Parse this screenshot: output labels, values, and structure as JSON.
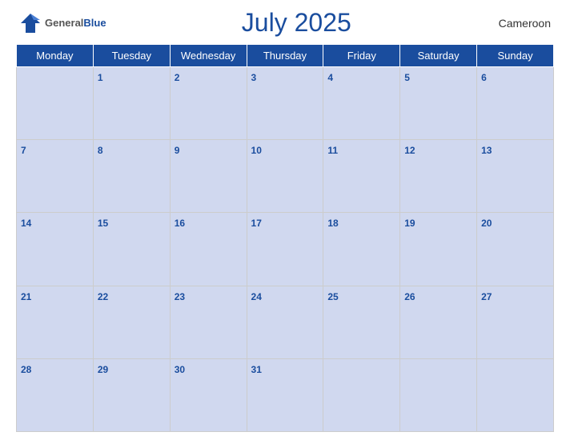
{
  "header": {
    "logo_general": "General",
    "logo_blue": "Blue",
    "title": "July 2025",
    "country": "Cameroon"
  },
  "days": [
    "Monday",
    "Tuesday",
    "Wednesday",
    "Thursday",
    "Friday",
    "Saturday",
    "Sunday"
  ],
  "weeks": [
    [
      null,
      1,
      2,
      3,
      4,
      5,
      6
    ],
    [
      7,
      8,
      9,
      10,
      11,
      12,
      13
    ],
    [
      14,
      15,
      16,
      17,
      18,
      19,
      20
    ],
    [
      21,
      22,
      23,
      24,
      25,
      26,
      27
    ],
    [
      28,
      29,
      30,
      31,
      null,
      null,
      null
    ]
  ]
}
